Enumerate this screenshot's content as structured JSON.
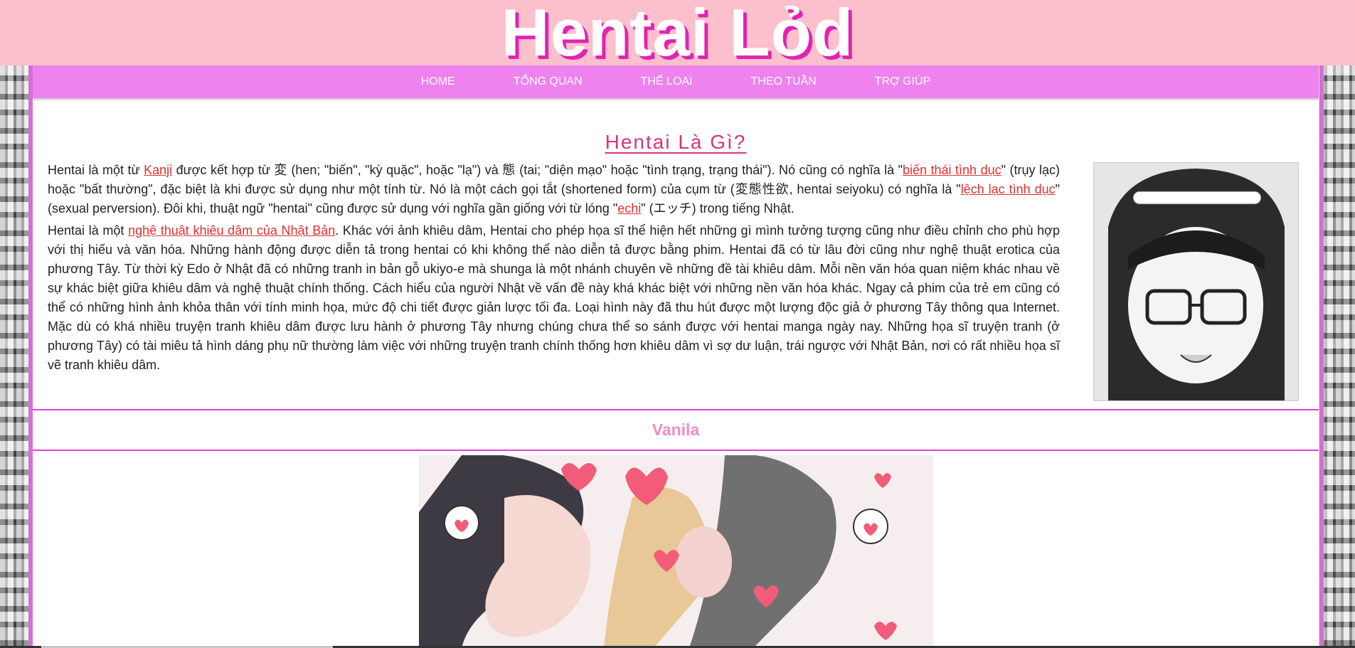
{
  "site": {
    "title": "Hentai Lỏd"
  },
  "nav": {
    "items": [
      "HOME",
      "TỔNG QUAN",
      "THỂ LOẠI",
      "THEO TUẦN",
      "TRỢ GIÚP"
    ]
  },
  "article": {
    "title": "Hentai Là Gì?",
    "p1": {
      "t1": "Hentai là một từ ",
      "l1": "Kanji",
      "t2": " được kết hợp từ 変 (hen; \"biến\", \"kỳ quặc\", hoặc \"lạ\") và 態 (tai; \"diện mạo\" hoặc \"tình trạng, trạng thái\"). Nó cũng có nghĩa là \"",
      "l2": "biến thái tình dục",
      "t3": "\" (trụy lạc) hoặc \"bất thường\", đặc biệt là khi được sử dụng như một tính từ. Nó là một cách gọi tắt (shortened form) của cụm từ (変態性欲, hentai seiyoku) có nghĩa là \"",
      "l3": "lệch lạc tình dục",
      "t4": "\" (sexual perversion). Đôi khi, thuật ngữ \"hentai\" cũng được sử dụng với nghĩa gần giống với từ lóng \"",
      "l4": "echi",
      "t5": "\" (エッチ) trong tiếng Nhật."
    },
    "p2": {
      "t1": "Hentai là một ",
      "l1": "nghệ thuật khiêu dâm của Nhật Bản",
      "t2": ". Khác với ảnh khiêu dâm, Hentai cho phép họa sĩ thể hiện hết những gì mình tưởng tượng cũng như điều chỉnh cho phù hợp với thị hiếu và văn hóa. Những hành động được diễn tả trong hentai có khi không thể nào diễn tả được bằng phim. Hentai đã có từ lâu đời cũng như nghệ thuật erotica của phương Tây. Từ thời kỳ Edo ở Nhật đã có những tranh in bản gỗ ukiyo-e mà shunga là một nhánh chuyên về những đề tài khiêu dâm. Mỗi nền văn hóa quan niệm khác nhau về sự khác biệt giữa khiêu dâm và nghệ thuật chính thống. Cách hiểu của người Nhật về vấn đề này khá khác biệt với những nền văn hóa khác. Ngay cả phim của trẻ em cũng có thể có những hình ảnh khỏa thân với tính minh họa, mức độ chi tiết được giản lược tối đa. Loại hình này đã thu hút được một lượng độc giả ở phương Tây thông qua Internet. Mặc dù có khá nhiều truyện tranh khiêu dâm được lưu hành ở phương Tây nhưng chúng chưa thể so sánh được với hentai manga ngày nay. Những họa sĩ truyện tranh (ở phương Tây) có tài miêu tả hình dáng phụ nữ thường làm việc với những truyện tranh chính thống hơn khiêu dâm vì sợ dư luận, trái ngược với Nhật Bản, nơi có rất nhiều họa sĩ vẽ tranh khiêu dâm."
    }
  },
  "section": {
    "title": "Vanila"
  },
  "colors": {
    "header_bg": "#fcc0cc",
    "nav_bg": "#ee82ee",
    "title_accent": "#e024b0",
    "link": "#e03030",
    "section_title": "#f08ccb",
    "divider": "#e040d8"
  },
  "icons": [
    "manga-illustration-image",
    "vanila-illustration-image"
  ]
}
